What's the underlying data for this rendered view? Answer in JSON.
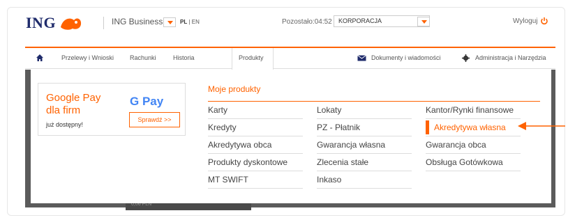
{
  "header": {
    "logo_text": "ING",
    "app_name": "ING Business",
    "lang_active": "PL",
    "lang_other": "EN",
    "remaining": "Pozostało:04:52",
    "context_select": "KORPORACJA",
    "logout": "Wyloguj",
    "brand_color": "#ff6200"
  },
  "nav": {
    "items": [
      "Przelewy i Wnioski",
      "Rachunki",
      "Historia",
      "Produkty"
    ],
    "active": "Produkty",
    "docs": "Dokumenty i wiadomości",
    "admin": "Administracja i Narzędzia"
  },
  "promo": {
    "title": "Google Pay dla firm",
    "subtitle": "już dostępny!",
    "logo": "G Pay",
    "button": "Sprawdź >>"
  },
  "menu": {
    "heading": "Moje produkty",
    "col1": [
      "Karty",
      "Kredyty",
      "Akredytywa obca",
      "Produkty dyskontowe",
      "MT SWIFT"
    ],
    "col2": [
      "Lokaty",
      "PZ - Płatnik",
      "Gwarancja własna",
      "Zlecenia stałe",
      "Inkaso"
    ],
    "col3": [
      "Kantor/Rynki finansowe",
      "Akredytywa własna",
      "Gwarancja obca",
      "Obsługa Gotówkowa"
    ],
    "active_item": "Akredytywa własna"
  },
  "background_hint": "0,06 PLN"
}
